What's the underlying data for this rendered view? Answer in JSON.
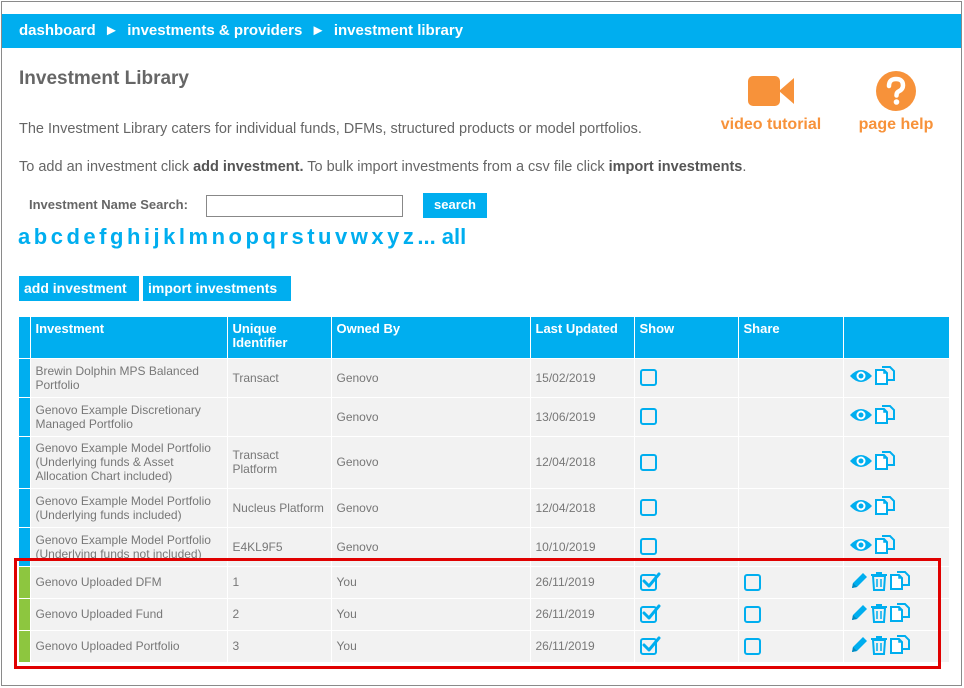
{
  "breadcrumb": {
    "items": [
      "dashboard",
      "investments & providers",
      "investment library"
    ],
    "separator": "►"
  },
  "page": {
    "title": "Investment Library",
    "intro": "The Investment Library caters for individual funds, DFMs, structured products or model portfolios.",
    "instructions": {
      "prefix": "To add an investment click ",
      "add_link": "add investment.",
      "middle": " To bulk import investments from a csv file click ",
      "import_link": "import investments",
      "suffix": "."
    }
  },
  "help": {
    "video_tutorial": "video tutorial",
    "page_help": "page help"
  },
  "search": {
    "label": "Investment Name Search:",
    "value": "",
    "button": "search"
  },
  "alphabet": [
    "a",
    "b",
    "c",
    "d",
    "e",
    "f",
    "g",
    "h",
    "i",
    "j",
    "k",
    "l",
    "m",
    "n",
    "o",
    "p",
    "q",
    "r",
    "s",
    "t",
    "u",
    "v",
    "w",
    "x",
    "y",
    "z",
    "... all"
  ],
  "buttons": {
    "add": "add investment",
    "import": "import investments"
  },
  "table": {
    "headers": {
      "investment": "Investment",
      "unique_identifier": "Unique Identifier",
      "owned_by": "Owned By",
      "last_updated": "Last Updated",
      "show": "Show",
      "share": "Share"
    },
    "rows": [
      {
        "investment": "Brewin Dolphin MPS Balanced Portfolio",
        "uid": "Transact",
        "owner": "Genovo",
        "date": "15/02/2019",
        "show": false,
        "share": null,
        "own": false
      },
      {
        "investment": "Genovo Example Discretionary Managed Portfolio",
        "uid": "",
        "owner": "Genovo",
        "date": "13/06/2019",
        "show": false,
        "share": null,
        "own": false
      },
      {
        "investment": "Genovo Example Model Portfolio (Underlying funds & Asset Allocation Chart included)",
        "uid": "Transact Platform",
        "owner": "Genovo",
        "date": "12/04/2018",
        "show": false,
        "share": null,
        "own": false
      },
      {
        "investment": "Genovo Example Model Portfolio (Underlying funds included)",
        "uid": "Nucleus Platform",
        "owner": "Genovo",
        "date": "12/04/2018",
        "show": false,
        "share": null,
        "own": false
      },
      {
        "investment": "Genovo Example Model Portfolio (Underlying funds not included)",
        "uid": "E4KL9F5",
        "owner": "Genovo",
        "date": "10/10/2019",
        "show": false,
        "share": null,
        "own": false
      },
      {
        "investment": "Genovo Uploaded DFM",
        "uid": "1",
        "owner": "You",
        "date": "26/11/2019",
        "show": true,
        "share": false,
        "own": true
      },
      {
        "investment": "Genovo Uploaded Fund",
        "uid": "2",
        "owner": "You",
        "date": "26/11/2019",
        "show": true,
        "share": false,
        "own": true
      },
      {
        "investment": "Genovo Uploaded Portfolio",
        "uid": "3",
        "owner": "You",
        "date": "26/11/2019",
        "show": true,
        "share": false,
        "own": true
      }
    ]
  },
  "colors": {
    "accent": "#00aeef",
    "help_orange": "#f7923a",
    "own_bar": "#8dc63f",
    "highlight": "#e00000"
  }
}
